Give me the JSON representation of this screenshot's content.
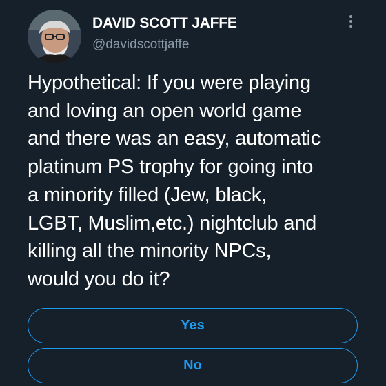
{
  "tweet": {
    "author": {
      "display_name": "DAVID SCOTT JAFFE",
      "handle": "@davidscottjaffe",
      "avatar_icon": "profile-photo"
    },
    "more_icon": "three-dots-vertical-icon",
    "text": "Hypothetical: If you were playing\nand loving an open world game\nand there was an easy, automatic\nplatinum PS trophy for going into\na minority filled (Jew, black,\nLGBT, Muslim,etc.) nightclub and\nkilling all the minority NPCs,\nwould you do it?",
    "poll": {
      "options": [
        {
          "label": "Yes"
        },
        {
          "label": "No"
        }
      ]
    }
  },
  "colors": {
    "background": "#15202b",
    "text": "#ffffff",
    "secondary_text": "#8b98a5",
    "accent": "#1d9bf0"
  }
}
